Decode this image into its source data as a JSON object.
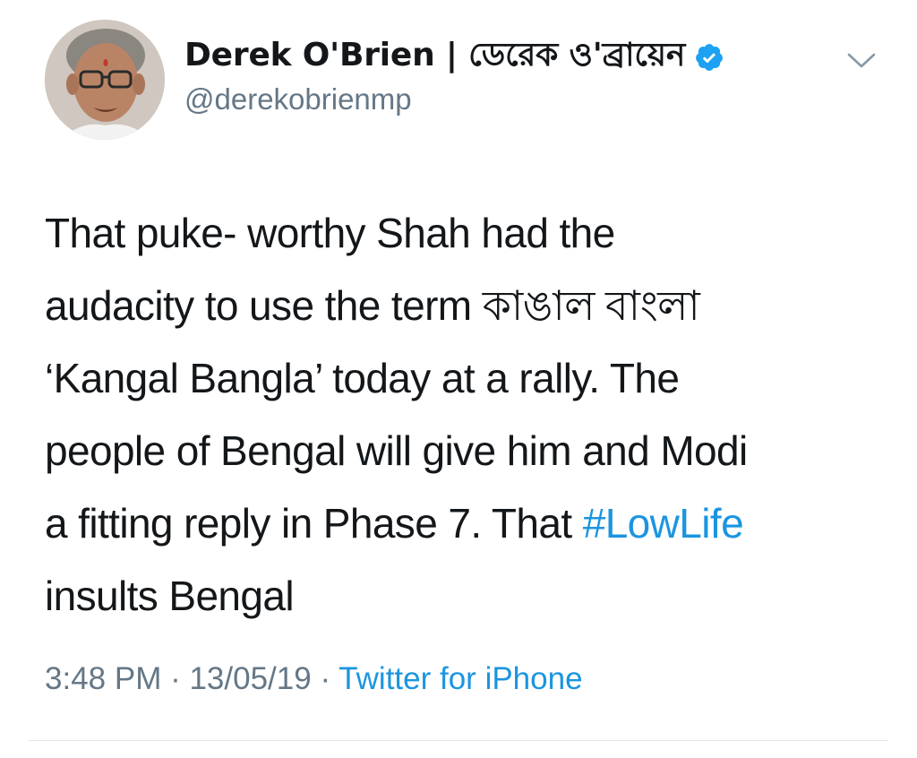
{
  "tweet": {
    "author": {
      "display_name": "Derek O'Brien | ডেরেক ও'ব্রায়েন",
      "handle": "@derekobrienmp",
      "verified": true
    },
    "body": {
      "line1": "That puke- worthy Shah had the",
      "line2": "audacity to use the term কাঙাল বাংলা",
      "line3": "‘Kangal Bangla’ today at a rally. The",
      "line4": "people of Bengal will give him and Modi",
      "line5_text": "a fitting reply in Phase 7. That ",
      "line5_hashtag": "#LowLife",
      "line6": "insults Bengal"
    },
    "meta": {
      "time": "3:48 PM",
      "separator1": " · ",
      "date": "13/05/19",
      "separator2": " · ",
      "source": "Twitter for iPhone"
    },
    "colors": {
      "link": "#1b95e0",
      "secondary_text": "#657786",
      "primary_text": "#14171a",
      "verified_badge": "#1da1f2"
    },
    "icons": {
      "verified": "verified-badge-icon",
      "menu": "chevron-down-icon"
    }
  }
}
